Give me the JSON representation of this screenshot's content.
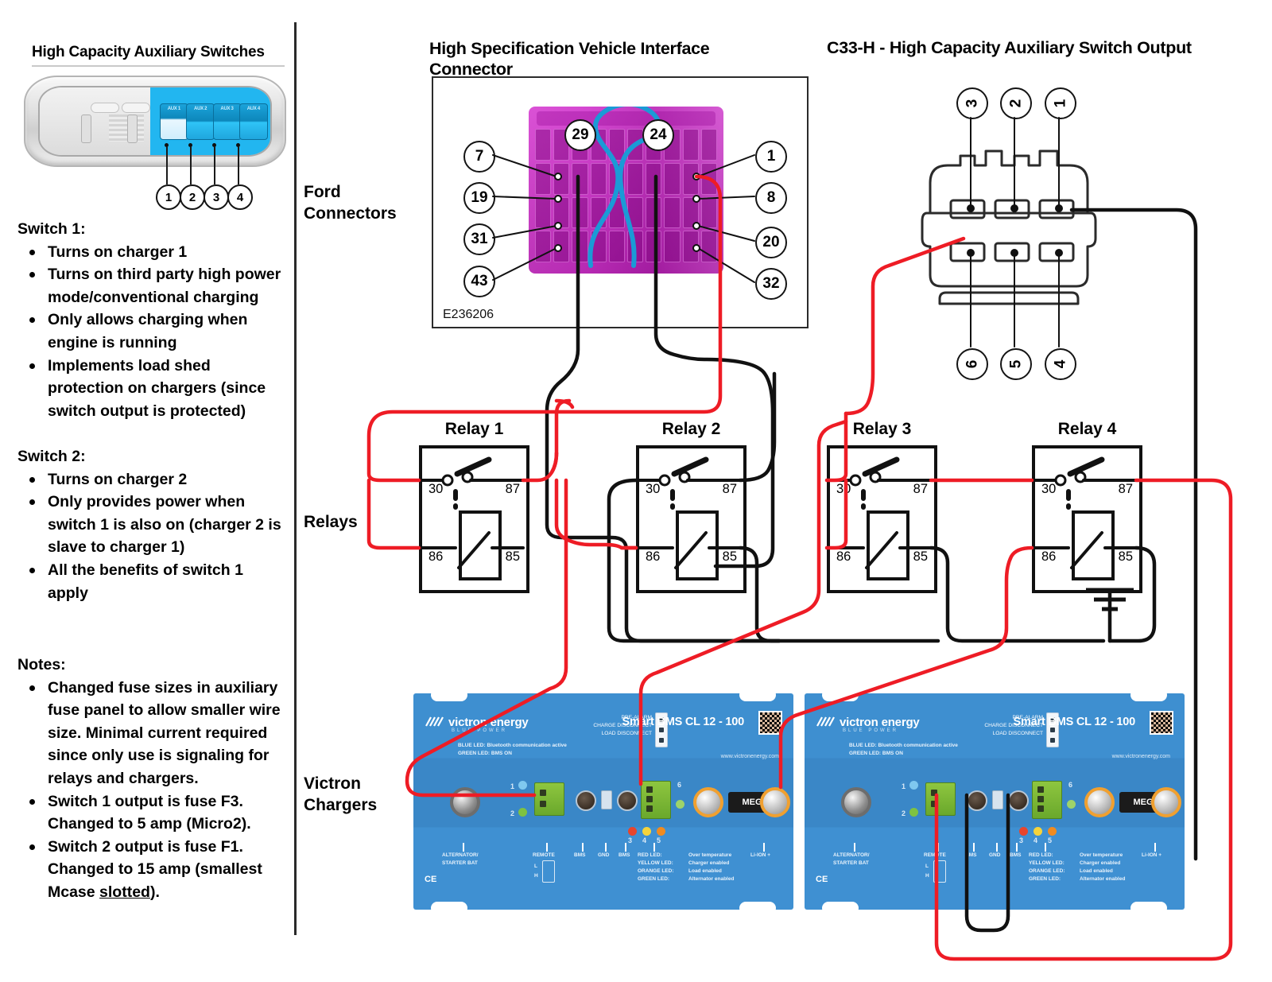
{
  "left_panel": {
    "title": "High Capacity Auxiliary Switches",
    "switch_callouts": [
      "1",
      "2",
      "3",
      "4"
    ],
    "switch_button_labels": [
      "AUX 1",
      "AUX 2",
      "AUX 3",
      "AUX 4"
    ],
    "switch1": {
      "heading": "Switch 1:",
      "bullets": [
        "Turns on charger 1",
        "Turns on third party high power mode/conventional charging",
        "Only allows charging when engine is running",
        "Implements load shed protection on chargers (since switch output is protected)"
      ]
    },
    "switch2": {
      "heading": "Switch 2:",
      "bullets": [
        "Turns on charger 2",
        "Only provides power when switch 1 is also on (charger 2 is slave to charger 1)",
        "All the benefits of switch 1 apply"
      ]
    },
    "notes": {
      "heading": "Notes:",
      "bullets": [
        "Changed fuse sizes in auxiliary fuse panel to allow smaller wire size.  Minimal current required since only use is signaling for relays and chargers.",
        "Switch 1 output is fuse F3. Changed to 5 amp (Micro2).",
        "Switch 2 output is fuse F1. Changed to 15 amp (smallest Mcase slotted)."
      ],
      "underlined_word": "slotted"
    }
  },
  "row_labels": {
    "ford": "Ford\nConnectors",
    "ford_line1": "Ford",
    "ford_line2": "Connectors",
    "relays": "Relays",
    "victron_line1": "Victron",
    "victron_line2": "Chargers"
  },
  "ford_connector": {
    "title_line1": "High Specification Vehicle Interface",
    "title_line2": "Connector",
    "part_code": "E236206",
    "pins_left": [
      "7",
      "19",
      "31",
      "43"
    ],
    "pins_top": [
      "29",
      "24"
    ],
    "pins_right": [
      "1",
      "8",
      "20",
      "32"
    ]
  },
  "c33_connector": {
    "title": "C33-H - High Capacity Auxiliary Switch Output",
    "pins_top": [
      "3",
      "2",
      "1"
    ],
    "pins_bottom": [
      "6",
      "5",
      "4"
    ]
  },
  "relays": [
    {
      "name": "Relay 1",
      "terminals": {
        "tl": "30",
        "tr": "87",
        "bl": "86",
        "br": "85"
      }
    },
    {
      "name": "Relay 2",
      "terminals": {
        "tl": "30",
        "tr": "87",
        "bl": "86",
        "br": "85"
      }
    },
    {
      "name": "Relay 3",
      "terminals": {
        "tl": "30",
        "tr": "87",
        "bl": "86",
        "br": "85"
      }
    },
    {
      "name": "Relay 4",
      "terminals": {
        "tl": "30",
        "tr": "87",
        "bl": "86",
        "br": "85"
      }
    }
  ],
  "victron": {
    "brand": "victron energy",
    "brand_sub": "BLUE POWER",
    "model": "Smart BMS CL 12 - 100",
    "website": "www.victronenergy.com",
    "header_signals": [
      "PRE-ALARM",
      "CHARGE DISCONNECT",
      "LOAD DISCONNECT"
    ],
    "led_notes": [
      "BLUE LED:    Bluetooth communication active",
      "GREEN LED:  BMS ON"
    ],
    "terminal_labels": [
      "ALTERNATOR/",
      "STARTER BAT",
      "REMOTE",
      "BMS",
      "GND",
      "BMS",
      "Li-ION +"
    ],
    "remote_sub": [
      "L",
      "H"
    ],
    "led_legend": [
      {
        "led": "RED LED:",
        "meaning": "Over temperature"
      },
      {
        "led": "YELLOW LED:",
        "meaning": "Charger enabled"
      },
      {
        "led": "ORANGE LED:",
        "meaning": "Load enabled"
      },
      {
        "led": "GREEN LED:",
        "meaning": "Alternator enabled"
      }
    ],
    "callout_numbers": [
      "1",
      "2",
      "3",
      "4",
      "5",
      "6"
    ],
    "fuse_label": "MEGA",
    "ce_mark": "CE"
  },
  "colors": {
    "wire_red": "#ee1c25",
    "wire_black": "#111111",
    "switch_blue": "#22b6f0",
    "connector_magenta": "#cf2fcb",
    "victron_blue": "#3e8fd0",
    "led_red": "#e8452c",
    "led_yellow": "#f5d33b",
    "led_orange": "#f08b20",
    "led_green": "#7ec242",
    "led_blue": "#7fc8ef"
  }
}
